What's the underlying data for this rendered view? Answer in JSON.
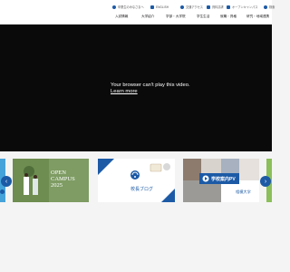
{
  "header": {
    "utility": [
      {
        "label": "卒業生のみなさまへ",
        "icon": "person-icon"
      },
      {
        "label": "ENGLISH",
        "icon": "globe-icon"
      },
      {
        "label": "交通アクセス",
        "icon": "map-pin-icon"
      },
      {
        "label": "資料請求",
        "icon": "mail-icon"
      },
      {
        "label": "オープンキャンパス",
        "icon": "calendar-icon"
      },
      {
        "label": "検索",
        "icon": "search-icon"
      }
    ],
    "nav": [
      "入試情報",
      "大学紹介",
      "学部・大学院",
      "学生生活",
      "就職・資格",
      "研究・地域連携"
    ]
  },
  "hero": {
    "message": "Your browser can't play this video.",
    "link": "Learn more"
  },
  "carousel": {
    "cards": [
      {
        "title": "OPEN CAMPUS",
        "year": "2025"
      },
      {
        "title": "校長ブログ"
      },
      {
        "title": "学校案内PV",
        "brand": "相模大学"
      }
    ],
    "prev": "‹",
    "next": "›"
  },
  "colors": {
    "brand": "#1c5aa6",
    "hero_bg": "#0a0a0a",
    "card_green": "#7b9a5e"
  }
}
